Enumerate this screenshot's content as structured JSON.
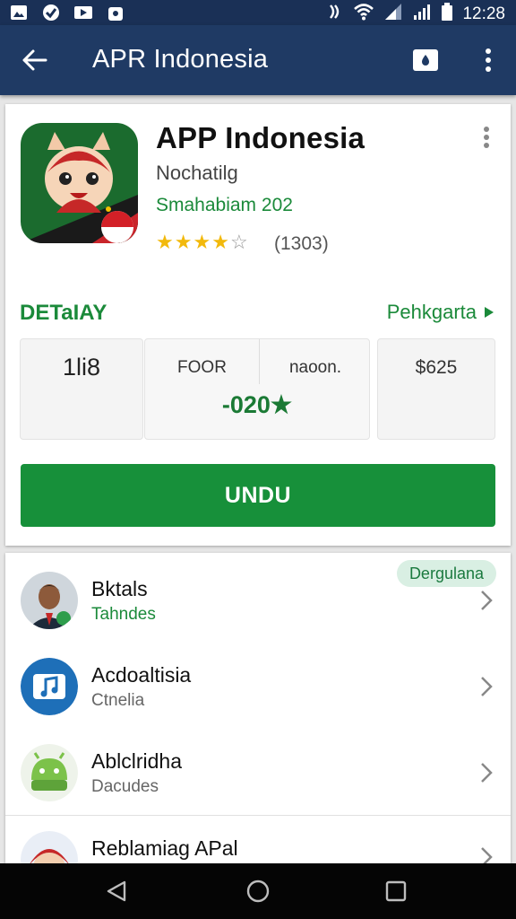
{
  "status_bar": {
    "time": "12:28"
  },
  "app_bar": {
    "title": "APR Indonesia"
  },
  "app": {
    "name": "APP Indonesia",
    "developer": "Nochatilg",
    "meta": "Smahabiam 202",
    "rating": 4,
    "rating_max": 5,
    "rating_count": "(1303)"
  },
  "details": {
    "label": "DETaIAY",
    "link": "Pehkgarta",
    "stats": {
      "box1": "1li8",
      "box2_left": "FOOR",
      "box2_right": "naoon.",
      "box2_big": "-020★",
      "box3": "$625"
    }
  },
  "download_button": "UNDU",
  "list": {
    "badge": "Dergulana",
    "items": [
      {
        "title": "Bktals",
        "subtitle": "Tahndes",
        "icon": "person-avatar-icon"
      },
      {
        "title": "Acdoaltisia",
        "subtitle": "Ctnelia",
        "icon": "music-app-icon"
      },
      {
        "title": "Ablclridha",
        "subtitle": "Dacudes",
        "icon": "android-icon"
      },
      {
        "title": "Reblamiag APal",
        "subtitle": "",
        "icon": "app-logo-icon"
      }
    ]
  },
  "colors": {
    "status_bar": "#1a3056",
    "app_bar": "#1f3a64",
    "accent_green": "#17903a",
    "star": "#f2b90c"
  }
}
